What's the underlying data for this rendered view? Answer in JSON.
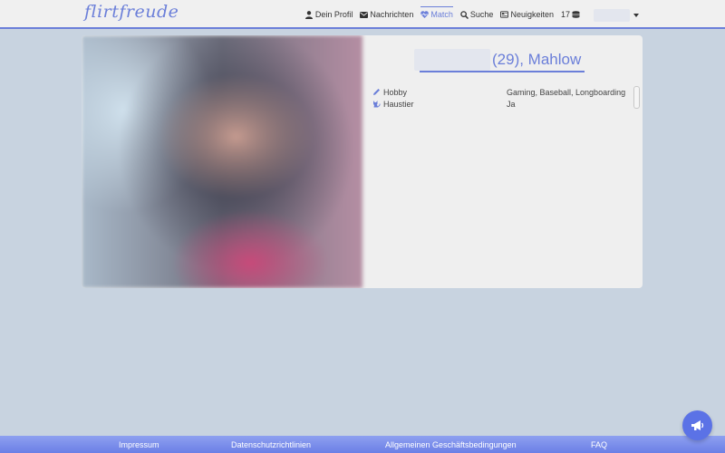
{
  "brand": {
    "logo_text": "flirtfreude",
    "accent_color": "#6b7fd9"
  },
  "nav": {
    "items": [
      {
        "label": "Dein Profil",
        "icon": "user-icon"
      },
      {
        "label": "Nachrichten",
        "icon": "envelope-icon"
      },
      {
        "label": "Match",
        "icon": "heart-pulse-icon",
        "active": true
      },
      {
        "label": "Suche",
        "icon": "search-icon"
      },
      {
        "label": "Neuigkeiten",
        "icon": "newspaper-icon"
      }
    ],
    "coins": "17"
  },
  "profile": {
    "name_suffix": "(29), Mahlow",
    "attributes": [
      {
        "label": "Hobby",
        "icon": "pencil-icon",
        "value": "Gaming, Baseball, Longboarding"
      },
      {
        "label": "Haustier",
        "icon": "cat-icon",
        "value": "Ja"
      }
    ]
  },
  "footer": {
    "links": [
      "Impressum",
      "Datenschutzrichtlinien",
      "Allgemeinen Geschäftsbedingungen",
      "FAQ"
    ]
  }
}
